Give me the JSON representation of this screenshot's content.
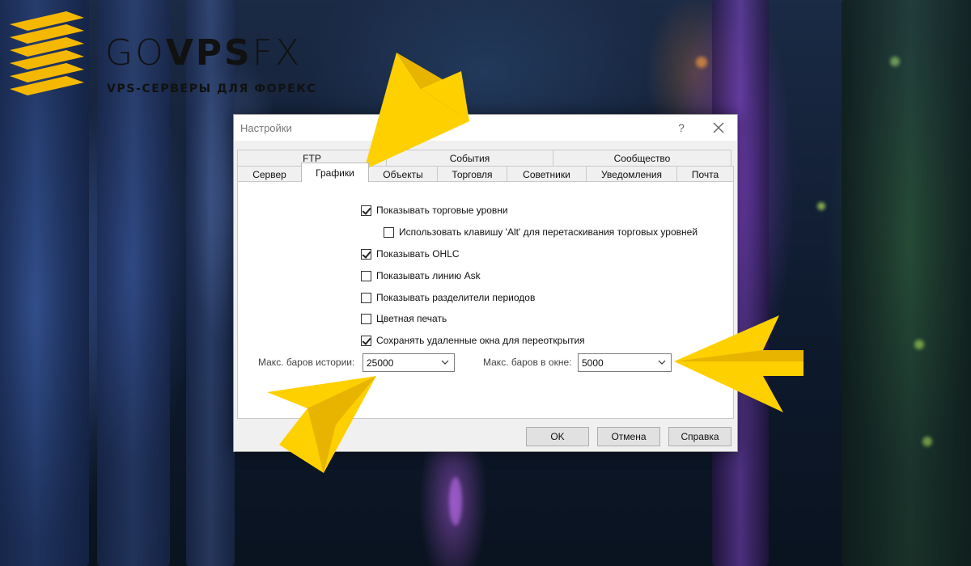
{
  "logo": {
    "word_light_left": "GO",
    "word_bold": "VPS",
    "word_light_right": "FX",
    "subtitle": "VPS-СЕРВЕРЫ ДЛЯ ФОРЕКС",
    "accent_color": "#f5b800"
  },
  "dialog": {
    "title": "Настройки",
    "help_glyph": "?",
    "close_glyph": "✕",
    "tabs_top": [
      "FTP",
      "События",
      "Сообщество"
    ],
    "tabs_bottom": [
      "Сервер",
      "Графики",
      "Объекты",
      "Торговля",
      "Советники",
      "Уведомления",
      "Почта"
    ],
    "active_tab": "Графики",
    "options": [
      {
        "label": "Показывать торговые уровни",
        "checked": true
      },
      {
        "label": "Использовать клавишу 'Alt' для перетаскивания торговых уровней",
        "checked": false
      },
      {
        "label": "Показывать OHLC",
        "checked": true
      },
      {
        "label": "Показывать линию Ask",
        "checked": false
      },
      {
        "label": "Показывать разделители периодов",
        "checked": false
      },
      {
        "label": "Цветная печать",
        "checked": false
      },
      {
        "label": "Сохранять удаленные окна для переоткрытия",
        "checked": true
      }
    ],
    "max_bars_history": {
      "label": "Макс. баров истории:",
      "value": "25000"
    },
    "max_bars_window": {
      "label": "Макс. баров в окне:",
      "value": "5000"
    },
    "buttons": {
      "ok": "OK",
      "cancel": "Отмена",
      "help": "Справка"
    }
  },
  "colors": {
    "arrow": "#ffd000",
    "arrow_shade": "#e8b400"
  }
}
